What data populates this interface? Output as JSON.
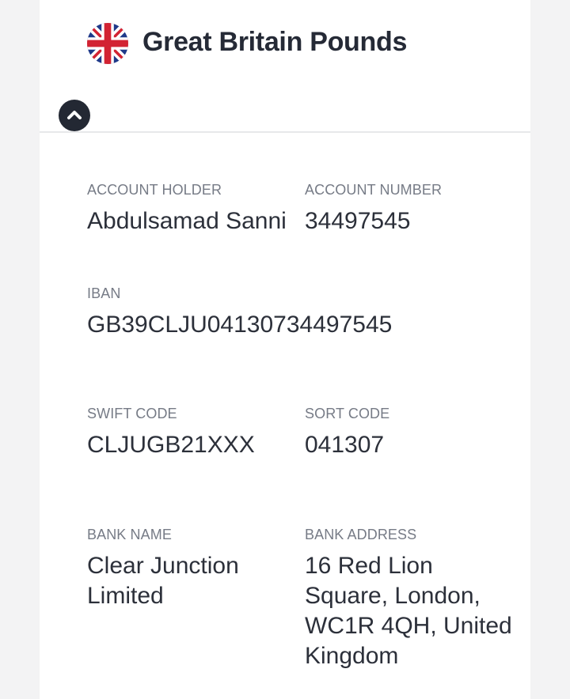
{
  "header": {
    "title": "Great Britain Pounds",
    "flag_icon": "uk-flag-icon",
    "collapse_icon": "chevron-up-icon"
  },
  "fields": {
    "account_holder": {
      "label": "ACCOUNT HOLDER",
      "value": "Abdulsamad Sanni"
    },
    "account_number": {
      "label": "ACCOUNT NUMBER",
      "value": "34497545"
    },
    "iban": {
      "label": "IBAN",
      "value": "GB39CLJU04130734497545"
    },
    "swift_code": {
      "label": "SWIFT CODE",
      "value": "CLJUGB21XXX"
    },
    "sort_code": {
      "label": "SORT CODE",
      "value": "041307"
    },
    "bank_name": {
      "label": "BANK NAME",
      "value": "Clear Junction Limited"
    },
    "bank_address": {
      "label": "BANK ADDRESS",
      "value": "16 Red Lion Square, London, WC1R 4QH, United Kingdom"
    }
  },
  "colors": {
    "background": "#f3f3f4",
    "card": "#ffffff",
    "title_text": "#252a36",
    "label_text": "#767b86",
    "value_text": "#2c303a",
    "button_bg": "#232833",
    "flag_blue": "#1f3a8a",
    "flag_red": "#d22333"
  }
}
